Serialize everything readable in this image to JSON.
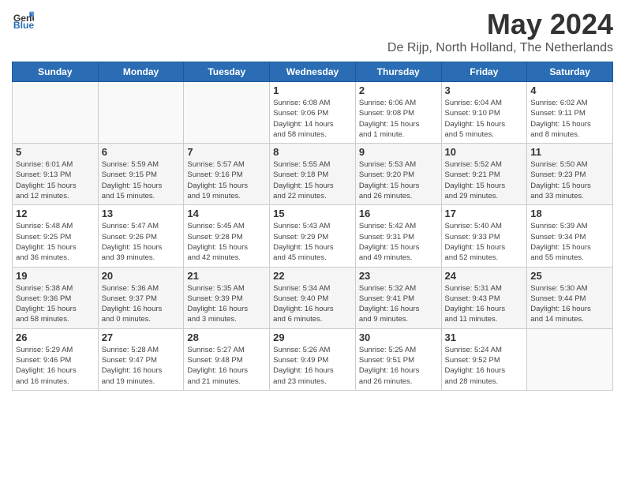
{
  "header": {
    "logo": {
      "general": "General",
      "blue": "Blue"
    },
    "title": "May 2024",
    "location": "De Rijp, North Holland, The Netherlands"
  },
  "calendar": {
    "days_of_week": [
      "Sunday",
      "Monday",
      "Tuesday",
      "Wednesday",
      "Thursday",
      "Friday",
      "Saturday"
    ],
    "weeks": [
      [
        {
          "day": "",
          "info": ""
        },
        {
          "day": "",
          "info": ""
        },
        {
          "day": "",
          "info": ""
        },
        {
          "day": "1",
          "info": "Sunrise: 6:08 AM\nSunset: 9:06 PM\nDaylight: 14 hours\nand 58 minutes."
        },
        {
          "day": "2",
          "info": "Sunrise: 6:06 AM\nSunset: 9:08 PM\nDaylight: 15 hours\nand 1 minute."
        },
        {
          "day": "3",
          "info": "Sunrise: 6:04 AM\nSunset: 9:10 PM\nDaylight: 15 hours\nand 5 minutes."
        },
        {
          "day": "4",
          "info": "Sunrise: 6:02 AM\nSunset: 9:11 PM\nDaylight: 15 hours\nand 8 minutes."
        }
      ],
      [
        {
          "day": "5",
          "info": "Sunrise: 6:01 AM\nSunset: 9:13 PM\nDaylight: 15 hours\nand 12 minutes."
        },
        {
          "day": "6",
          "info": "Sunrise: 5:59 AM\nSunset: 9:15 PM\nDaylight: 15 hours\nand 15 minutes."
        },
        {
          "day": "7",
          "info": "Sunrise: 5:57 AM\nSunset: 9:16 PM\nDaylight: 15 hours\nand 19 minutes."
        },
        {
          "day": "8",
          "info": "Sunrise: 5:55 AM\nSunset: 9:18 PM\nDaylight: 15 hours\nand 22 minutes."
        },
        {
          "day": "9",
          "info": "Sunrise: 5:53 AM\nSunset: 9:20 PM\nDaylight: 15 hours\nand 26 minutes."
        },
        {
          "day": "10",
          "info": "Sunrise: 5:52 AM\nSunset: 9:21 PM\nDaylight: 15 hours\nand 29 minutes."
        },
        {
          "day": "11",
          "info": "Sunrise: 5:50 AM\nSunset: 9:23 PM\nDaylight: 15 hours\nand 33 minutes."
        }
      ],
      [
        {
          "day": "12",
          "info": "Sunrise: 5:48 AM\nSunset: 9:25 PM\nDaylight: 15 hours\nand 36 minutes."
        },
        {
          "day": "13",
          "info": "Sunrise: 5:47 AM\nSunset: 9:26 PM\nDaylight: 15 hours\nand 39 minutes."
        },
        {
          "day": "14",
          "info": "Sunrise: 5:45 AM\nSunset: 9:28 PM\nDaylight: 15 hours\nand 42 minutes."
        },
        {
          "day": "15",
          "info": "Sunrise: 5:43 AM\nSunset: 9:29 PM\nDaylight: 15 hours\nand 45 minutes."
        },
        {
          "day": "16",
          "info": "Sunrise: 5:42 AM\nSunset: 9:31 PM\nDaylight: 15 hours\nand 49 minutes."
        },
        {
          "day": "17",
          "info": "Sunrise: 5:40 AM\nSunset: 9:33 PM\nDaylight: 15 hours\nand 52 minutes."
        },
        {
          "day": "18",
          "info": "Sunrise: 5:39 AM\nSunset: 9:34 PM\nDaylight: 15 hours\nand 55 minutes."
        }
      ],
      [
        {
          "day": "19",
          "info": "Sunrise: 5:38 AM\nSunset: 9:36 PM\nDaylight: 15 hours\nand 58 minutes."
        },
        {
          "day": "20",
          "info": "Sunrise: 5:36 AM\nSunset: 9:37 PM\nDaylight: 16 hours\nand 0 minutes."
        },
        {
          "day": "21",
          "info": "Sunrise: 5:35 AM\nSunset: 9:39 PM\nDaylight: 16 hours\nand 3 minutes."
        },
        {
          "day": "22",
          "info": "Sunrise: 5:34 AM\nSunset: 9:40 PM\nDaylight: 16 hours\nand 6 minutes."
        },
        {
          "day": "23",
          "info": "Sunrise: 5:32 AM\nSunset: 9:41 PM\nDaylight: 16 hours\nand 9 minutes."
        },
        {
          "day": "24",
          "info": "Sunrise: 5:31 AM\nSunset: 9:43 PM\nDaylight: 16 hours\nand 11 minutes."
        },
        {
          "day": "25",
          "info": "Sunrise: 5:30 AM\nSunset: 9:44 PM\nDaylight: 16 hours\nand 14 minutes."
        }
      ],
      [
        {
          "day": "26",
          "info": "Sunrise: 5:29 AM\nSunset: 9:46 PM\nDaylight: 16 hours\nand 16 minutes."
        },
        {
          "day": "27",
          "info": "Sunrise: 5:28 AM\nSunset: 9:47 PM\nDaylight: 16 hours\nand 19 minutes."
        },
        {
          "day": "28",
          "info": "Sunrise: 5:27 AM\nSunset: 9:48 PM\nDaylight: 16 hours\nand 21 minutes."
        },
        {
          "day": "29",
          "info": "Sunrise: 5:26 AM\nSunset: 9:49 PM\nDaylight: 16 hours\nand 23 minutes."
        },
        {
          "day": "30",
          "info": "Sunrise: 5:25 AM\nSunset: 9:51 PM\nDaylight: 16 hours\nand 26 minutes."
        },
        {
          "day": "31",
          "info": "Sunrise: 5:24 AM\nSunset: 9:52 PM\nDaylight: 16 hours\nand 28 minutes."
        },
        {
          "day": "",
          "info": ""
        }
      ]
    ]
  }
}
